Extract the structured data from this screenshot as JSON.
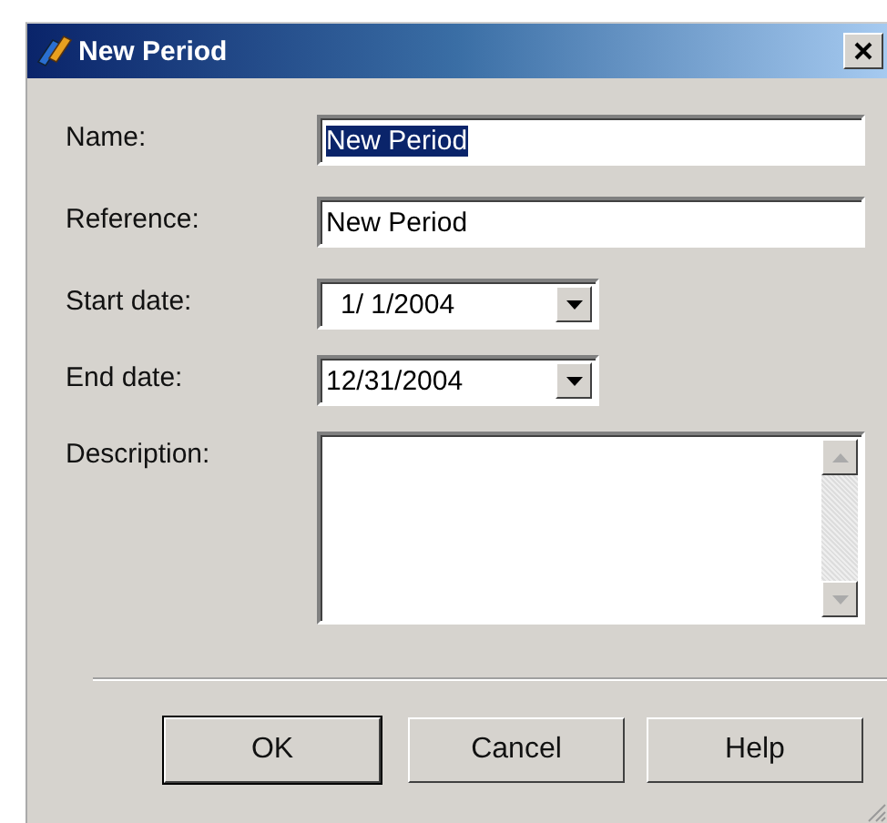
{
  "window": {
    "title": "New Period"
  },
  "fields": [
    {
      "kind": "text",
      "label": "Name:",
      "value": "New Period",
      "highlighted": true
    },
    {
      "kind": "text",
      "label": "Reference:",
      "value": "New Period",
      "highlighted": false
    },
    {
      "kind": "date",
      "label": "Start date:",
      "value": "1/ 1/2004"
    },
    {
      "kind": "date",
      "label": "End date:",
      "value": "12/31/2004"
    },
    {
      "kind": "textarea",
      "label": "Description:"
    }
  ],
  "buttons": [
    {
      "label": "OK",
      "default": true
    },
    {
      "label": "Cancel",
      "default": false
    },
    {
      "label": "Help",
      "default": false
    }
  ]
}
